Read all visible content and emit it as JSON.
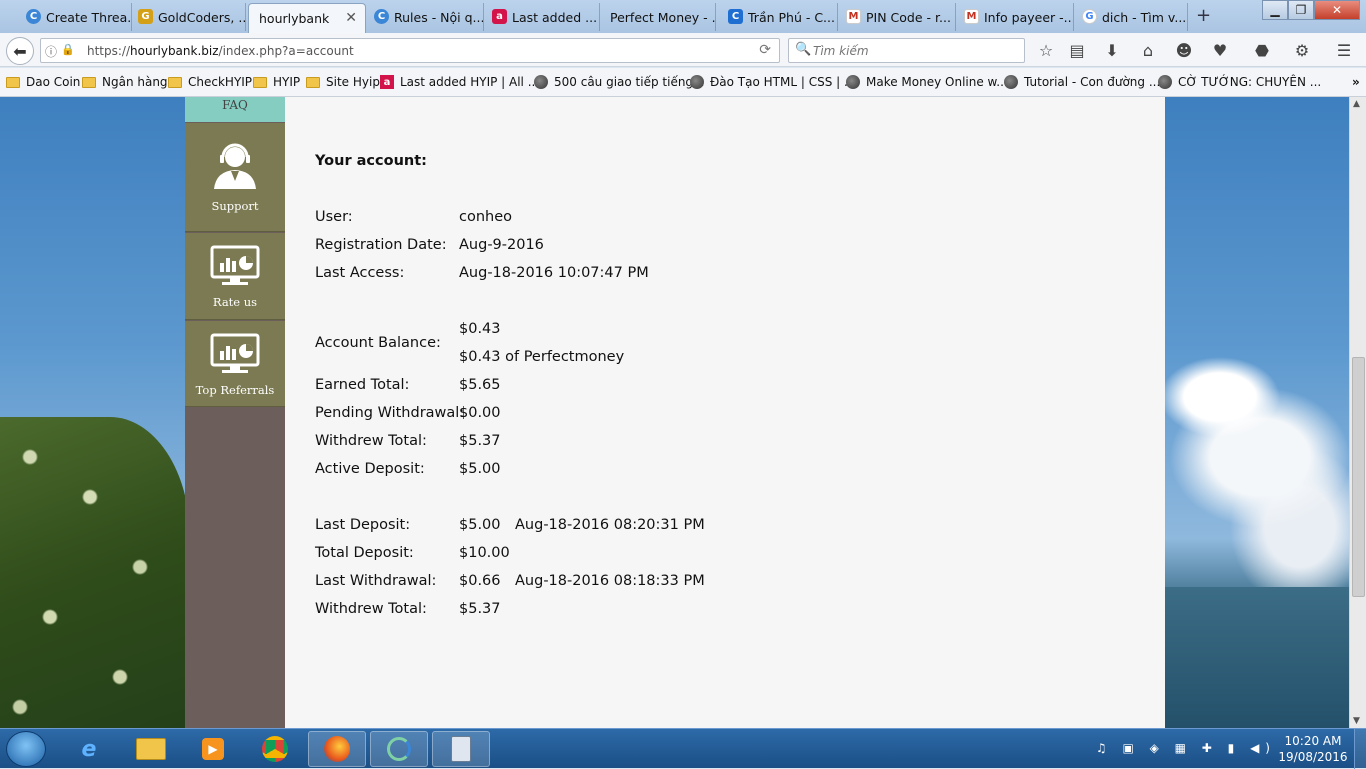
{
  "browser": {
    "tabs": [
      {
        "label": "Create Threa...",
        "icon": "c-circle-icon",
        "color": "#3b86d6"
      },
      {
        "label": "GoldCoders, ...",
        "icon": "gc-icon",
        "color": "#d4a017"
      },
      {
        "label": "hourlybank",
        "icon": "",
        "color": "",
        "active": true
      },
      {
        "label": "Rules - Nội q...",
        "icon": "c-circle-icon",
        "color": "#3b86d6"
      },
      {
        "label": "Last added ...",
        "icon": "a-red-icon",
        "color": "#d2144a"
      },
      {
        "label": "Perfect Money - ...",
        "icon": "",
        "color": ""
      },
      {
        "label": "Trần Phú - C...",
        "icon": "c-square-icon",
        "color": "#1e6fd1"
      },
      {
        "label": "PIN Code - r...",
        "icon": "gmail-icon",
        "color": "#c23321"
      },
      {
        "label": "Info payeer -...",
        "icon": "gmail-icon",
        "color": "#c23321"
      },
      {
        "label": "dich - Tìm v...",
        "icon": "google-icon",
        "color": "#4285f4"
      }
    ],
    "url": {
      "prefix": "https://",
      "domain": "hourlybank.biz",
      "path": "/index.php?a=account"
    },
    "search_placeholder": "Tìm kiếm",
    "bookmarks": [
      {
        "label": "Dao Coin",
        "icon": "folder"
      },
      {
        "label": "Ngân hàng",
        "icon": "folder"
      },
      {
        "label": "CheckHYIP",
        "icon": "folder"
      },
      {
        "label": "HYIP",
        "icon": "folder"
      },
      {
        "label": "Site Hyip",
        "icon": "folder"
      },
      {
        "label": "Last added HYIP | All ...",
        "icon": "a-red"
      },
      {
        "label": "500 câu giao tiếp tiếng...",
        "icon": "globe"
      },
      {
        "label": "Đào Tạo HTML | CSS | ...",
        "icon": "globe"
      },
      {
        "label": "Make Money Online w...",
        "icon": "globe"
      },
      {
        "label": "Tutorial - Con đường ...",
        "icon": "globe"
      },
      {
        "label": "CỜ TƯỚNG: CHUYÊN ...",
        "icon": "globe"
      }
    ]
  },
  "sidebar": {
    "faq_label": "FAQ",
    "items": [
      {
        "label": "Support",
        "icon": "support-agent-icon"
      },
      {
        "label": "Rate us",
        "icon": "monitor-chart-icon"
      },
      {
        "label": "Top Referrals",
        "icon": "monitor-chart-icon"
      }
    ]
  },
  "account": {
    "title": "Your account:",
    "rows": [
      {
        "label": "User:",
        "value": "conheo"
      },
      {
        "label": "Registration Date:",
        "value": "Aug-9-2016"
      },
      {
        "label": "Last Access:",
        "value": "Aug-18-2016 10:07:47 PM"
      },
      {
        "label": "Account Balance:",
        "value": "$0.43",
        "value2": "$0.43 of Perfectmoney"
      },
      {
        "label": "Earned Total:",
        "value": "$5.65"
      },
      {
        "label": "Pending Withdrawal:",
        "value": "$0.00"
      },
      {
        "label": "Withdrew Total:",
        "value": "$5.37"
      },
      {
        "label": "Active Deposit:",
        "value": "$5.00"
      },
      {
        "label": "Last Deposit:",
        "value": "$5.00",
        "date": "Aug-18-2016 08:20:31 PM"
      },
      {
        "label": "Total Deposit:",
        "value": "$10.00"
      },
      {
        "label": "Last Withdrawal:",
        "value": "$0.66",
        "date": "Aug-18-2016 08:18:33 PM"
      },
      {
        "label": "Withdrew Total:",
        "value": "$5.37"
      }
    ]
  },
  "taskbar": {
    "time": "10:20 AM",
    "date": "19/08/2016"
  }
}
